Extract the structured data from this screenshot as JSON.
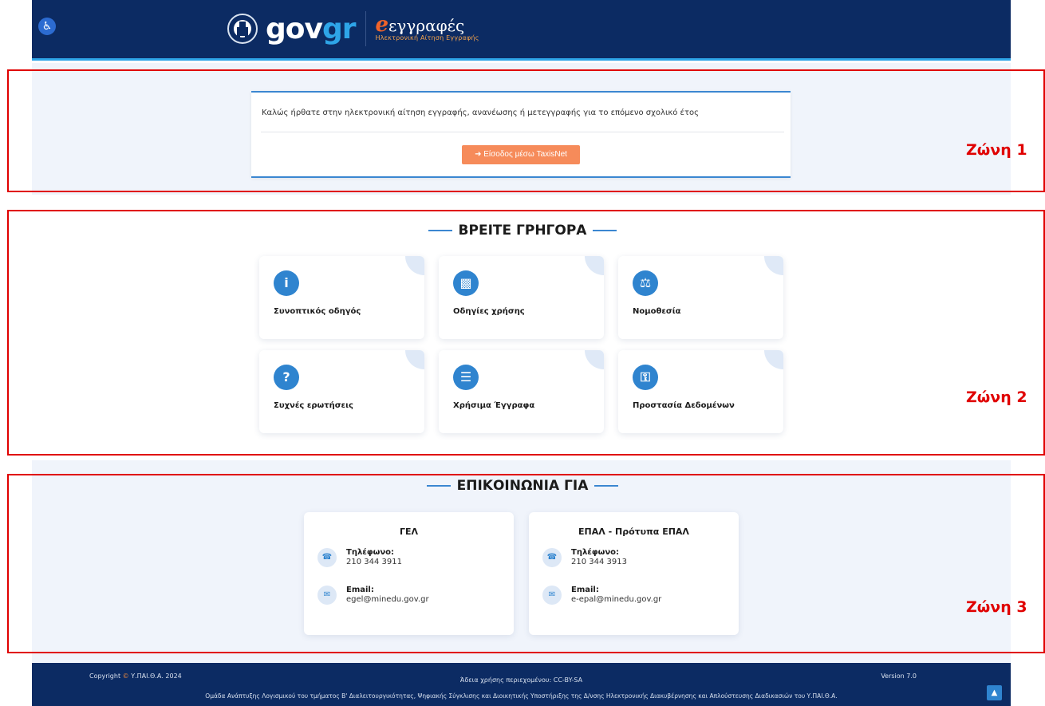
{
  "header": {
    "accessibility_icon": "wheelchair-icon",
    "gov_brand": "gov",
    "gov_brand_accent": "gr",
    "app_initial": "e",
    "app_title": "εγγραφές",
    "app_subtitle": "Ηλεκτρονική Αίτηση Εγγραφής"
  },
  "welcome": {
    "text": "Καλώς ήρθατε στην ηλεκτρονική αίτηση εγγραφής, ανανέωσης ή μετεγγραφής για το επόμενο σχολικό έτος",
    "login_icon": "sign-in-icon",
    "login_label": "Είσοδος μέσω TaxisNet"
  },
  "quick": {
    "title": "ΒΡΕΙΤΕ ΓΡΗΓΟΡΑ",
    "items": [
      {
        "label": "Συνοπτικός οδηγός",
        "icon": "info-icon"
      },
      {
        "label": "Οδηγίες χρήσης",
        "icon": "book-icon"
      },
      {
        "label": "Νομοθεσία",
        "icon": "scales-icon"
      },
      {
        "label": "Συχνές ερωτήσεις",
        "icon": "question-icon"
      },
      {
        "label": "Χρήσιμα Έγγραφα",
        "icon": "document-icon"
      },
      {
        "label": "Προστασία Δεδομένων",
        "icon": "key-icon"
      }
    ]
  },
  "contact": {
    "title": "ΕΠΙΚΟΙΝΩΝΙΑ ΓΙΑ",
    "cards": [
      {
        "title": "ΓΕΛ",
        "phone_label": "Τηλέφωνο:",
        "phone": "210 344 3911",
        "email_label": "Email:",
        "email": "egel@minedu.gov.gr"
      },
      {
        "title": "ΕΠΑΛ - Πρότυπα ΕΠΑΛ",
        "phone_label": "Τηλέφωνο:",
        "phone": "210 344 3913",
        "email_label": "Email:",
        "email": "e-epal@minedu.gov.gr"
      }
    ]
  },
  "footer": {
    "copyright_prefix": "Copyright",
    "copyright_symbol": "©",
    "copyright_org": "Υ.ΠΑΙ.Θ.Α. 2024",
    "license": "Άδεια χρήσης περιεχομένου: CC-BY-SA",
    "version": "Version 7.0",
    "team": "Ομάδα Ανάπτυξης Λογισμικού του τμήματος Β' Διαλειτουργικότητας, Ψηφιακής Σύγκλισης και Διοικητικής Υποστήριξης της Δ/νσης Ηλεκτρονικής Διακυβέρνησης και Απλούστευσης Διαδικασιών του Υ.ΠΑΙ.Θ.Α.",
    "to_top_icon": "chevron-up-icon"
  },
  "zones": [
    "Ζώνη 1",
    "Ζώνη 2",
    "Ζώνη 3"
  ],
  "colors": {
    "header_bg": "#0c2b63",
    "accent_blue": "#2ea5e8",
    "button_orange": "#f68b5a",
    "annotation_red": "#e00000"
  }
}
